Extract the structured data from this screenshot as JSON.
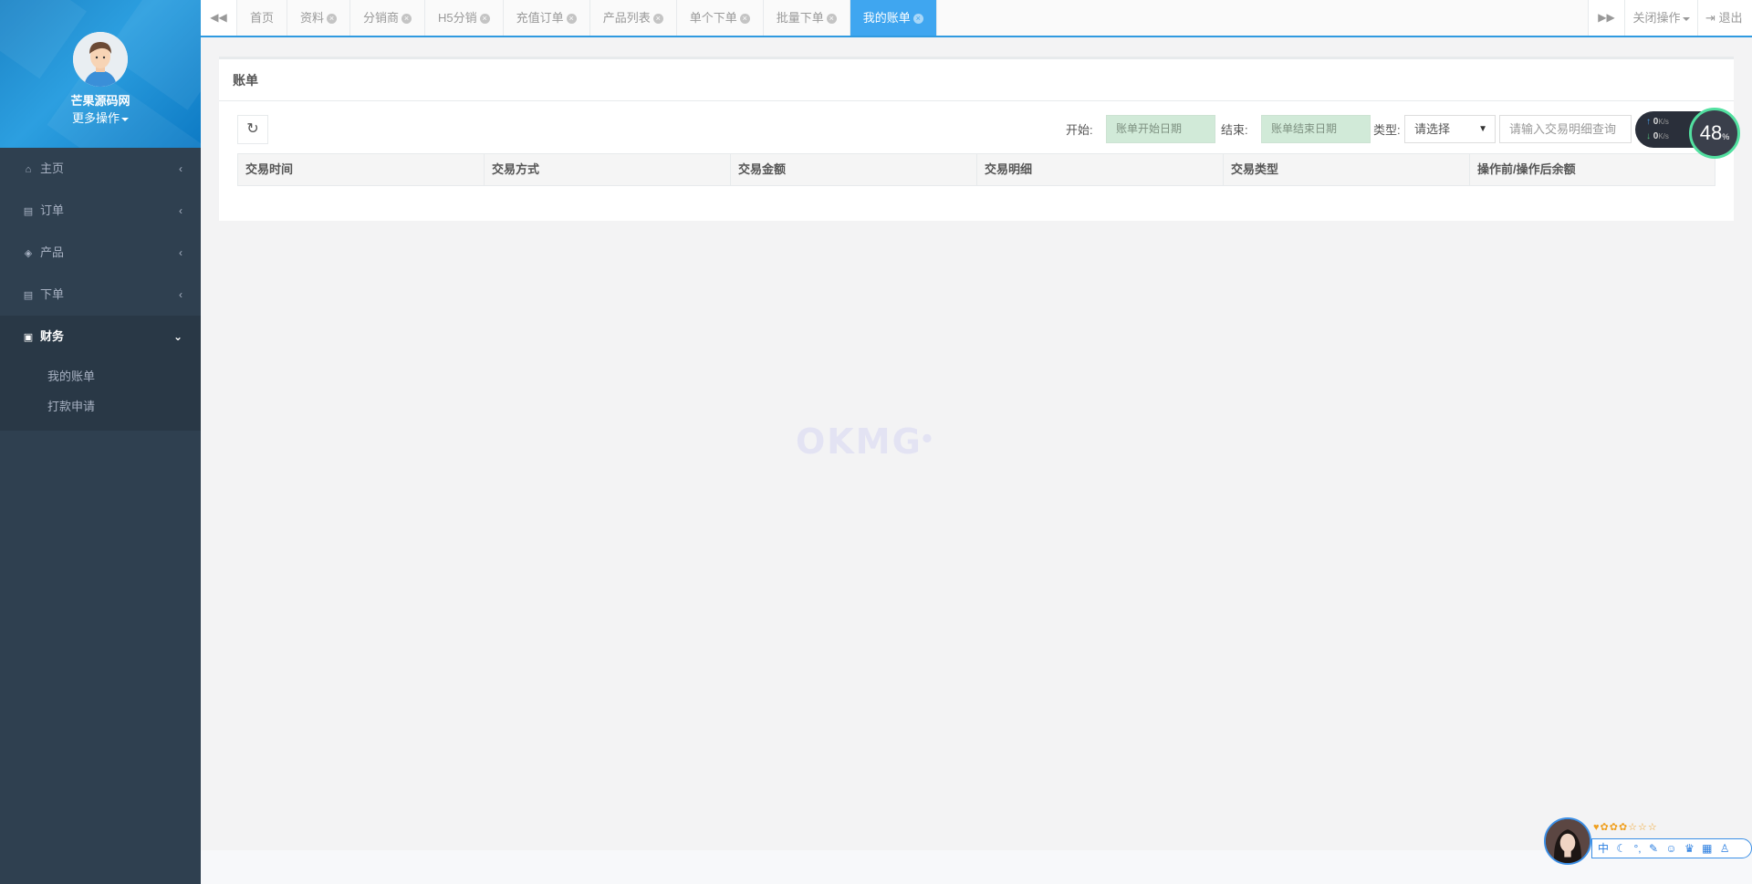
{
  "sidebar": {
    "profile_name": "芒果源码网",
    "profile_more": "更多操作",
    "items": [
      {
        "label": "主页",
        "icon": "home-icon"
      },
      {
        "label": "订单",
        "icon": "file-icon"
      },
      {
        "label": "产品",
        "icon": "cube-icon"
      },
      {
        "label": "下单",
        "icon": "file-icon"
      },
      {
        "label": "财务",
        "icon": "money-icon"
      }
    ],
    "submenu": [
      "我的账单",
      "打款申请"
    ]
  },
  "tabs": [
    {
      "label": "首页"
    },
    {
      "label": "资料"
    },
    {
      "label": "分销商"
    },
    {
      "label": "H5分销"
    },
    {
      "label": "充值订单"
    },
    {
      "label": "产品列表"
    },
    {
      "label": "单个下单"
    },
    {
      "label": "批量下单"
    },
    {
      "label": "我的账单"
    }
  ],
  "topbar": {
    "close_ops": "关闭操作",
    "logout": "退出"
  },
  "panel": {
    "title": "账单",
    "start_label": "开始:",
    "start_placeholder": "账单开始日期",
    "end_label": "结束:",
    "end_placeholder": "账单结束日期",
    "type_label": "类型:",
    "type_selected": "请选择",
    "search_placeholder": "请输入交易明细查询",
    "columns": [
      "交易时间",
      "交易方式",
      "交易金额",
      "交易明细",
      "交易类型",
      "操作前/操作后余额"
    ]
  },
  "watermark": "OKMG",
  "speed_widget": {
    "up": "0",
    "down": "0",
    "unit": "K/s",
    "percent": "48",
    "percent_sign": "%"
  },
  "ime_bar": {
    "stars": "♥✿✿✿☆☆☆",
    "items": [
      "中",
      "☾",
      "°,",
      "✎",
      "☺",
      "♛",
      "▦",
      "♙"
    ]
  },
  "colors": {
    "sidebar_bg": "#2f4050",
    "accent": "#3fa6f0",
    "profile_bg": "#1c84c6",
    "date_input_bg": "#d1ead8"
  }
}
